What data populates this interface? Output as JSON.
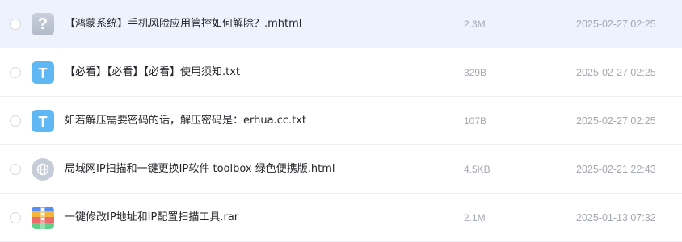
{
  "files": [
    {
      "name": "【鸿蒙系统】手机风险应用管控如何解除？.mhtml",
      "size": "2.3M",
      "date": "2025-02-27 02:25",
      "icon": "unknown-file-icon",
      "icon_glyph": "?",
      "selected": true
    },
    {
      "name": "【必看】【必看】【必看】使用须知.txt",
      "size": "329B",
      "date": "2025-02-27 02:25",
      "icon": "text-file-icon",
      "icon_glyph": "T",
      "selected": false
    },
    {
      "name": "如若解压需要密码的话，解压密码是：erhua.cc.txt",
      "size": "107B",
      "date": "2025-02-27 02:25",
      "icon": "text-file-icon",
      "icon_glyph": "T",
      "selected": false
    },
    {
      "name": "局域网IP扫描和一键更换IP软件 toolbox 绿色便携版.html",
      "size": "4.5KB",
      "date": "2025-02-21 22:43",
      "icon": "web-file-icon",
      "icon_glyph": "",
      "selected": false
    },
    {
      "name": "一键修改IP地址和IP配置扫描工具.rar",
      "size": "2.1M",
      "date": "2025-01-13 07:32",
      "icon": "archive-file-icon",
      "icon_glyph": "",
      "selected": false
    }
  ],
  "colors": {
    "selected_row_bg": "#eef2fd",
    "text_icon_bg": "#5fb8f4",
    "unknown_icon_bg": "#b9c0ce",
    "meta_text": "#a4a8b3"
  }
}
